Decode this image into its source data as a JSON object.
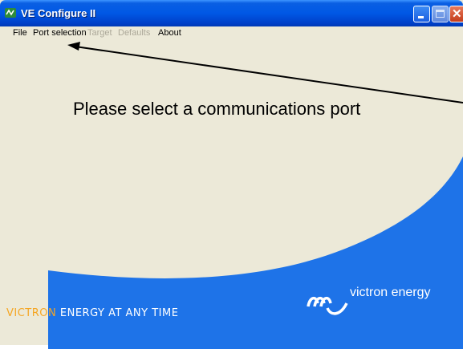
{
  "window": {
    "title": "VE Configure II",
    "title_bar_color": "#0058E5"
  },
  "menu": {
    "items": [
      {
        "label": "File",
        "enabled": true
      },
      {
        "label": "Port selection",
        "enabled": true
      },
      {
        "label": "Target",
        "enabled": false
      },
      {
        "label": "Defaults",
        "enabled": false
      },
      {
        "label": "About",
        "enabled": true
      }
    ]
  },
  "content": {
    "prompt": "Please select a communications port",
    "background_color": "#ECE9D8",
    "accent_color": "#1E73E8"
  },
  "branding": {
    "logo_text": "victron energy",
    "tagline_brand": "VICTRON",
    "tagline_rest": "ENERGY AT ANY TIME",
    "tagline_brand_color": "#F5A623"
  },
  "icons": [
    "app-icon",
    "minimize-icon",
    "maximize-icon",
    "close-icon",
    "victron-logo-icon",
    "arrow-pointer-icon"
  ]
}
